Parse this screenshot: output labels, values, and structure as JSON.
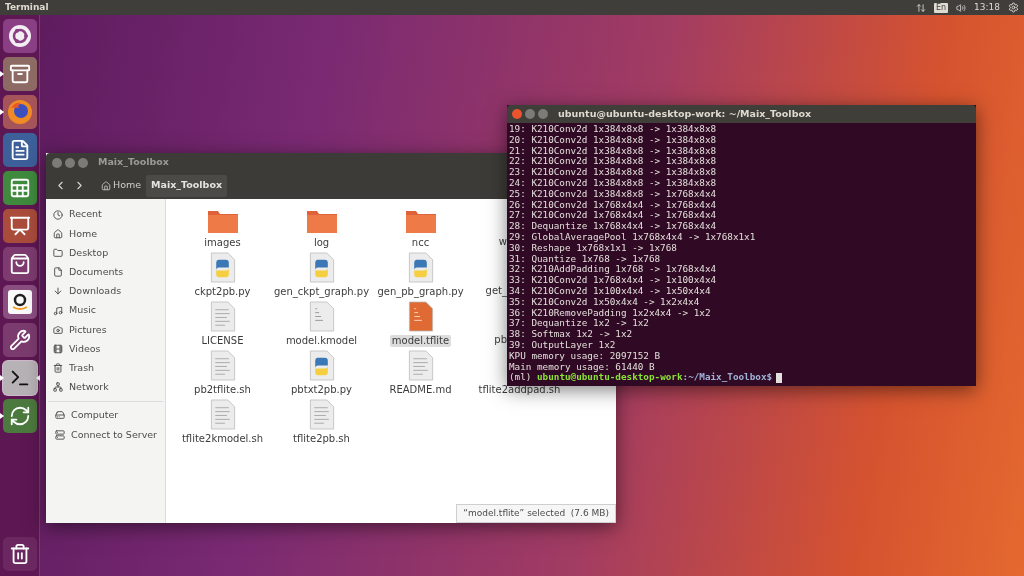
{
  "top_bar": {
    "app_title": "Terminal",
    "keyboard_layout": "En",
    "clock": "13:18"
  },
  "launcher": {
    "items": [
      {
        "kind": "dash",
        "running": false,
        "focused": false
      },
      {
        "kind": "files",
        "running": true,
        "focused": false
      },
      {
        "kind": "browser",
        "running": true,
        "focused": false
      },
      {
        "kind": "writer",
        "running": false,
        "focused": false
      },
      {
        "kind": "calc",
        "running": false,
        "focused": false
      },
      {
        "kind": "impress",
        "running": false,
        "focused": false
      },
      {
        "kind": "software",
        "running": false,
        "focused": false
      },
      {
        "kind": "shop",
        "running": false,
        "focused": false
      },
      {
        "kind": "settings",
        "running": false,
        "focused": false
      },
      {
        "kind": "terminal",
        "running": true,
        "focused": true
      },
      {
        "kind": "updater",
        "running": true,
        "focused": false
      }
    ],
    "trash": {
      "kind": "trash"
    }
  },
  "file_manager": {
    "title": "Maix_Toolbox",
    "path": [
      {
        "label": "Home",
        "selected": false
      },
      {
        "label": "Maix_Toolbox",
        "selected": true
      }
    ],
    "sidebar": {
      "sections": [
        [
          {
            "label": "Recent",
            "kind": "clock"
          },
          {
            "label": "Home",
            "kind": "home"
          },
          {
            "label": "Desktop",
            "kind": "folder"
          },
          {
            "label": "Documents",
            "kind": "file"
          },
          {
            "label": "Downloads",
            "kind": "download"
          },
          {
            "label": "Music",
            "kind": "music"
          },
          {
            "label": "Pictures",
            "kind": "camera"
          },
          {
            "label": "Videos",
            "kind": "film"
          },
          {
            "label": "Trash",
            "kind": "trash"
          },
          {
            "label": "Network",
            "kind": "network"
          }
        ],
        [
          {
            "label": "Computer",
            "kind": "computer"
          },
          {
            "label": "Connect to Server",
            "kind": "server"
          }
        ]
      ]
    },
    "files": [
      {
        "name": "images",
        "kind": "folder",
        "selected": false
      },
      {
        "name": "log",
        "kind": "folder",
        "selected": false
      },
      {
        "name": "ncc",
        "kind": "folder",
        "selected": false
      },
      {
        "name": "w",
        "kind": "cut",
        "selected": false
      },
      {
        "name": "ckpt2pb.py",
        "kind": "python",
        "selected": false
      },
      {
        "name": "gen_ckpt_graph.py",
        "kind": "python",
        "selected": false
      },
      {
        "name": "gen_pb_graph.py",
        "kind": "python",
        "selected": false
      },
      {
        "name": "get_",
        "kind": "cut",
        "selected": false
      },
      {
        "name": "LICENSE",
        "kind": "text",
        "selected": false
      },
      {
        "name": "model.kmodel",
        "kind": "binary",
        "selected": false
      },
      {
        "name": "model.tflite",
        "kind": "tflite",
        "selected": true
      },
      {
        "name": "pb",
        "kind": "cut",
        "selected": false
      },
      {
        "name": "pb2tflite.sh",
        "kind": "text",
        "selected": false
      },
      {
        "name": "pbtxt2pb.py",
        "kind": "python",
        "selected": false
      },
      {
        "name": "README.md",
        "kind": "text",
        "selected": false
      },
      {
        "name": "tflite2addpad.sh",
        "kind": "label_only",
        "selected": false
      },
      {
        "name": "tflite2kmodel.sh",
        "kind": "text",
        "selected": false
      },
      {
        "name": "tflite2pb.sh",
        "kind": "text",
        "selected": false
      }
    ],
    "status": "“model.tflite” selected  (7.6 MB)"
  },
  "terminal": {
    "title": "ubuntu@ubuntu-desktop-work: ~/Maix_Toolbox",
    "lines": [
      "19: K210Conv2d 1x384x8x8 -> 1x384x8x8",
      "20: K210Conv2d 1x384x8x8 -> 1x384x8x8",
      "21: K210Conv2d 1x384x8x8 -> 1x384x8x8",
      "22: K210Conv2d 1x384x8x8 -> 1x384x8x8",
      "23: K210Conv2d 1x384x8x8 -> 1x384x8x8",
      "24: K210Conv2d 1x384x8x8 -> 1x384x8x8",
      "25: K210Conv2d 1x384x8x8 -> 1x768x4x4",
      "26: K210Conv2d 1x768x4x4 -> 1x768x4x4",
      "27: K210Conv2d 1x768x4x4 -> 1x768x4x4",
      "28: Dequantize 1x768x4x4 -> 1x768x4x4",
      "29: GlobalAveragePool 1x768x4x4 -> 1x768x1x1",
      "30: Reshape 1x768x1x1 -> 1x768",
      "31: Quantize 1x768 -> 1x768",
      "32: K210AddPadding 1x768 -> 1x768x4x4",
      "33: K210Conv2d 1x768x4x4 -> 1x100x4x4",
      "34: K210Conv2d 1x100x4x4 -> 1x50x4x4",
      "35: K210Conv2d 1x50x4x4 -> 1x2x4x4",
      "36: K210RemovePadding 1x2x4x4 -> 1x2",
      "37: Dequantize 1x2 -> 1x2",
      "38: Softmax 1x2 -> 1x2",
      "39: OutputLayer 1x2",
      "KPU memory usage: 2097152 B",
      "Main memory usage: 61440 B"
    ],
    "prompt": {
      "env": "(ml)",
      "user_host": "ubuntu@ubuntu-desktop-work",
      "path": ":~/Maix_Toolbox$"
    }
  }
}
